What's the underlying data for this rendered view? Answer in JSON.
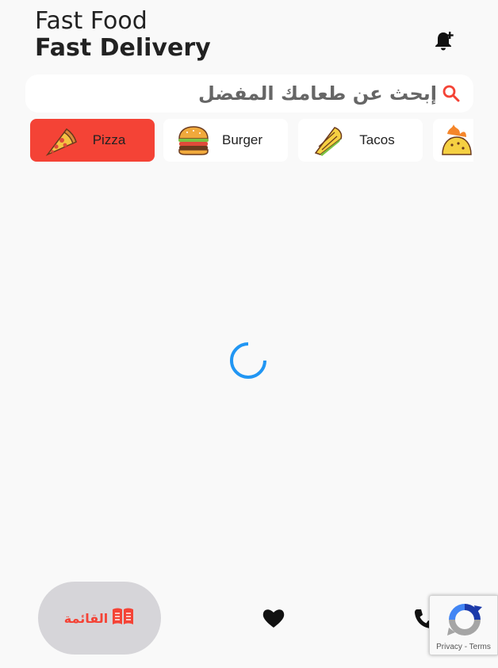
{
  "header": {
    "title_line1": "Fast Food",
    "title_line2": "Fast Delivery",
    "bell_icon": "bell-plus-icon"
  },
  "search": {
    "placeholder": "إبحث عن طعامك المفضل",
    "icon": "search-icon",
    "icon_color": "#f44336"
  },
  "categories": [
    {
      "label": "Pizza",
      "icon": "pizza-icon",
      "active": true
    },
    {
      "label": "Burger",
      "icon": "burger-icon",
      "active": false
    },
    {
      "label": "Tacos",
      "icon": "tacos-icon",
      "active": false
    },
    {
      "label": "",
      "icon": "spicy-taco-icon",
      "active": false
    }
  ],
  "colors": {
    "accent": "#f44336",
    "background": "#f9f9f9",
    "spinner": "#2196f3",
    "nav_pill": "#d6d5d9"
  },
  "loading": true,
  "bottom_nav": {
    "menu_label": "القائمة",
    "menu_icon": "menu-book-icon",
    "favorites_icon": "heart-icon",
    "call_icon": "phone-icon"
  },
  "recaptcha": {
    "privacy": "Privacy",
    "separator": " - ",
    "terms": "Terms"
  }
}
